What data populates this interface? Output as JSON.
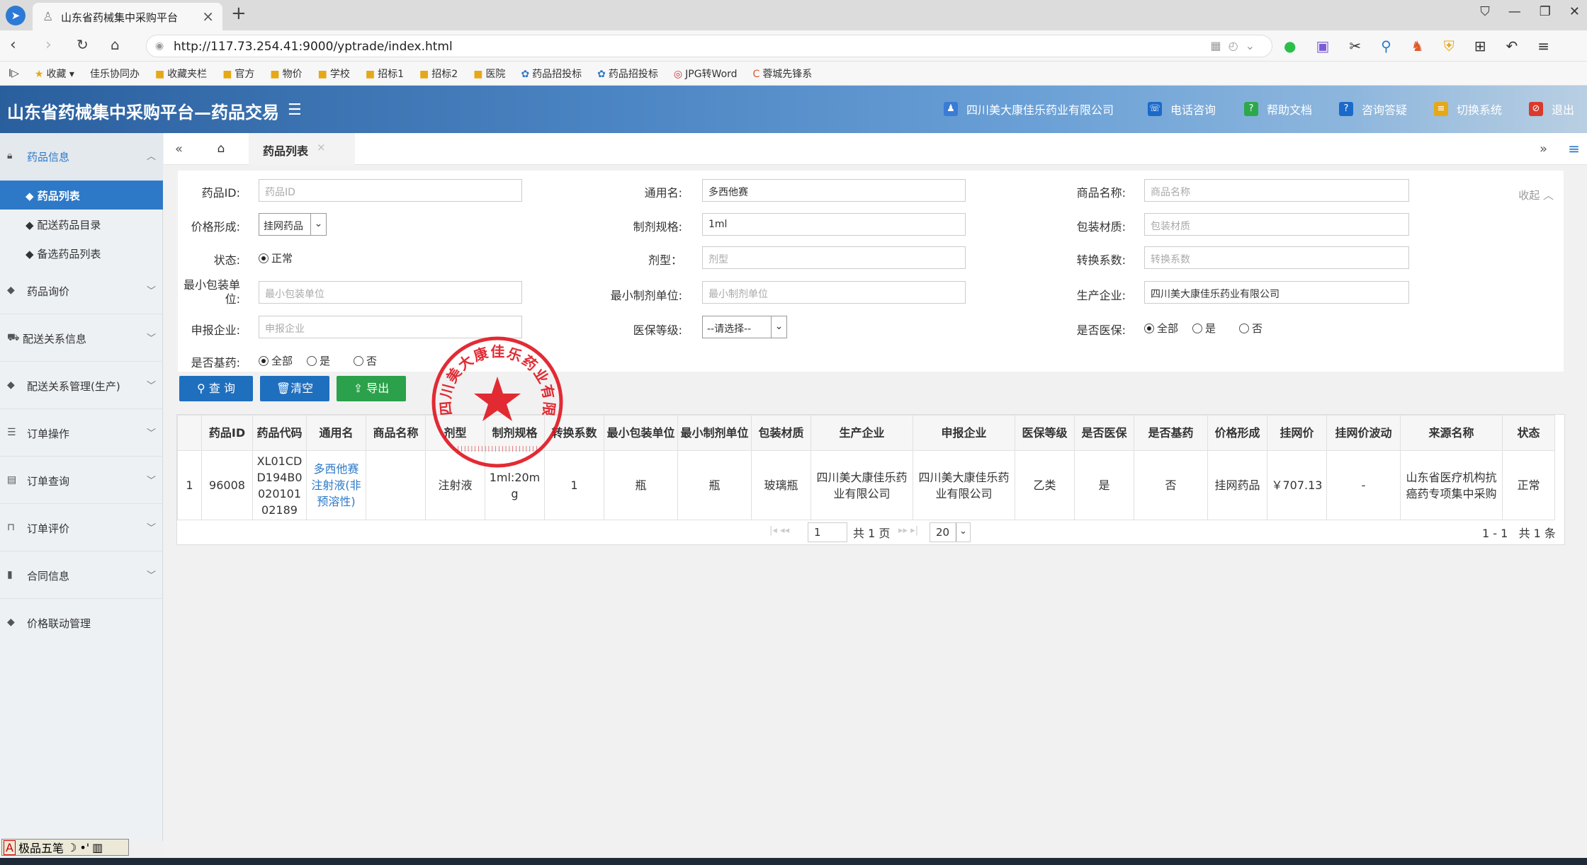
{
  "browser": {
    "tab_title": "山东省药械集中采购平台",
    "url": "http://117.73.254.41:9000/yptrade/index.html",
    "bookmarks": [
      "收藏",
      "佳乐协同办",
      "收藏夹栏",
      "官方",
      "物价",
      "学校",
      "招标1",
      "招标2",
      "医院",
      "药品招投标",
      "药品招投标",
      "JPG转Word",
      "蓉城先锋系"
    ]
  },
  "header": {
    "title": "山东省药械集中采购平台—药品交易",
    "company": "四川美大康佳乐药业有限公司",
    "links": [
      "电话咨询",
      "帮助文档",
      "咨询答疑",
      "切换系统",
      "退出"
    ]
  },
  "sidebar": {
    "sections": [
      {
        "label": "药品信息",
        "icon": "lock-icon"
      },
      {
        "label": "药品询价",
        "icon": "diamond-icon"
      },
      {
        "label": "配送关系信息",
        "icon": "truck-icon"
      },
      {
        "label": "配送关系管理(生产)",
        "icon": "diamond-icon"
      },
      {
        "label": "订单操作",
        "icon": "list-icon"
      },
      {
        "label": "订单查询",
        "icon": "document-icon"
      },
      {
        "label": "订单评价",
        "icon": "lock-icon"
      },
      {
        "label": "合同信息",
        "icon": "book-icon"
      },
      {
        "label": "价格联动管理",
        "icon": "diamond-icon"
      }
    ],
    "sub_items": [
      "药品列表",
      "配送药品目录",
      "备选药品列表"
    ]
  },
  "content_tabs": {
    "active": "药品列表"
  },
  "form": {
    "labels": {
      "drug_id": "药品ID:",
      "generic_name": "通用名:",
      "trade_name": "商品名称:",
      "price_form": "价格形成:",
      "spec": "制剂规格:",
      "package_material": "包装材质:",
      "status": "状态:",
      "dosage_form": "剂型：",
      "conversion": "转换系数:",
      "min_package_unit": "最小包装单位:",
      "min_prep_unit": "最小制剂单位:",
      "manufacturer": "生产企业:",
      "applicant": "申报企业:",
      "insurance_level": "医保等级:",
      "is_insurance": "是否医保:",
      "is_basic": "是否基药:"
    },
    "placeholders": {
      "drug_id": "药品ID",
      "trade_name": "商品名称",
      "package_material": "包装材质",
      "dosage_form": "剂型",
      "conversion": "转换系数",
      "min_package_unit": "最小包装单位",
      "min_prep_unit": "最小制剂单位",
      "applicant": "申报企业"
    },
    "values": {
      "generic_name": "多西他赛",
      "spec": "1ml",
      "manufacturer": "四川美大康佳乐药业有限公司",
      "price_form": "挂网药品",
      "insurance_level": "--请选择--",
      "status": "正常"
    },
    "radio_all": "全部",
    "radio_yes": "是",
    "radio_no": "否",
    "collapse": "收起"
  },
  "buttons": {
    "query": "查 询",
    "clear": "清空",
    "export": "导出"
  },
  "table": {
    "headers": [
      "药品ID",
      "药品代码",
      "通用名",
      "商品名称",
      "剂型",
      "制剂规格",
      "转换系数",
      "最小包装单位",
      "最小制剂单位",
      "包装材质",
      "生产企业",
      "申报企业",
      "医保等级",
      "是否医保",
      "是否基药",
      "价格形成",
      "挂网价",
      "挂网价波动",
      "来源名称",
      "状态"
    ],
    "rows": [
      {
        "index": "1",
        "drug_id": "96008",
        "code": "XL01CDD194B002010102189",
        "generic": "多西他赛注射液(非预溶性)",
        "trade": "",
        "form": "注射液",
        "spec": "1ml:20mg",
        "conv": "1",
        "min_pkg": "瓶",
        "min_prep": "瓶",
        "material": "玻璃瓶",
        "maker": "四川美大康佳乐药业有限公司",
        "applicant": "四川美大康佳乐药业有限公司",
        "ins_level": "乙类",
        "is_ins": "是",
        "is_basic": "否",
        "price_form": "挂网药品",
        "price": "￥707.13",
        "fluct": "-",
        "source": "山东省医疗机构抗癌药专项集中采购",
        "status": "正常"
      }
    ]
  },
  "pager": {
    "page": "1",
    "total_pages": "共 1 页",
    "page_size": "20",
    "range": "1 - 1",
    "total": "共 1 条"
  },
  "seal": {
    "text": "四川美大康佳乐药业有限公司",
    "color": "#e0141e"
  },
  "ime": {
    "label": "极品五笔"
  }
}
